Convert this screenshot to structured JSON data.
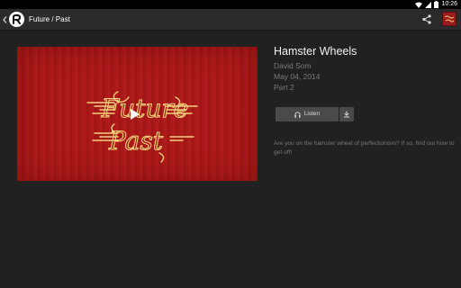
{
  "status_bar": {
    "time": "10:26"
  },
  "app_bar": {
    "title": "Future / Past",
    "back_icon": "chevron-left-icon",
    "logo_icon": "app-logo-icon",
    "share_icon": "share-icon",
    "thumbnail_icon": "podcast-thumbnail-icon"
  },
  "video": {
    "artwork_text_line1": "Future",
    "artwork_text_line2": "Past",
    "play_icon": "play-icon"
  },
  "episode": {
    "title": "Hamster Wheels",
    "author": "David Som",
    "date": "May 04, 2014",
    "part": "Part 2",
    "listen_label": "Listen",
    "listen_icon": "headphones-icon",
    "download_icon": "download-icon",
    "description": "Are you on the hamster wheel of perfectionism?  If so, find out how to get off!"
  },
  "colors": {
    "background": "#212121",
    "app_bar": "#2b2b2b",
    "artwork_red": "#a81818",
    "artwork_gold": "#f1d27a",
    "button": "#4a4a4a",
    "muted_text": "#7a7a7a"
  }
}
